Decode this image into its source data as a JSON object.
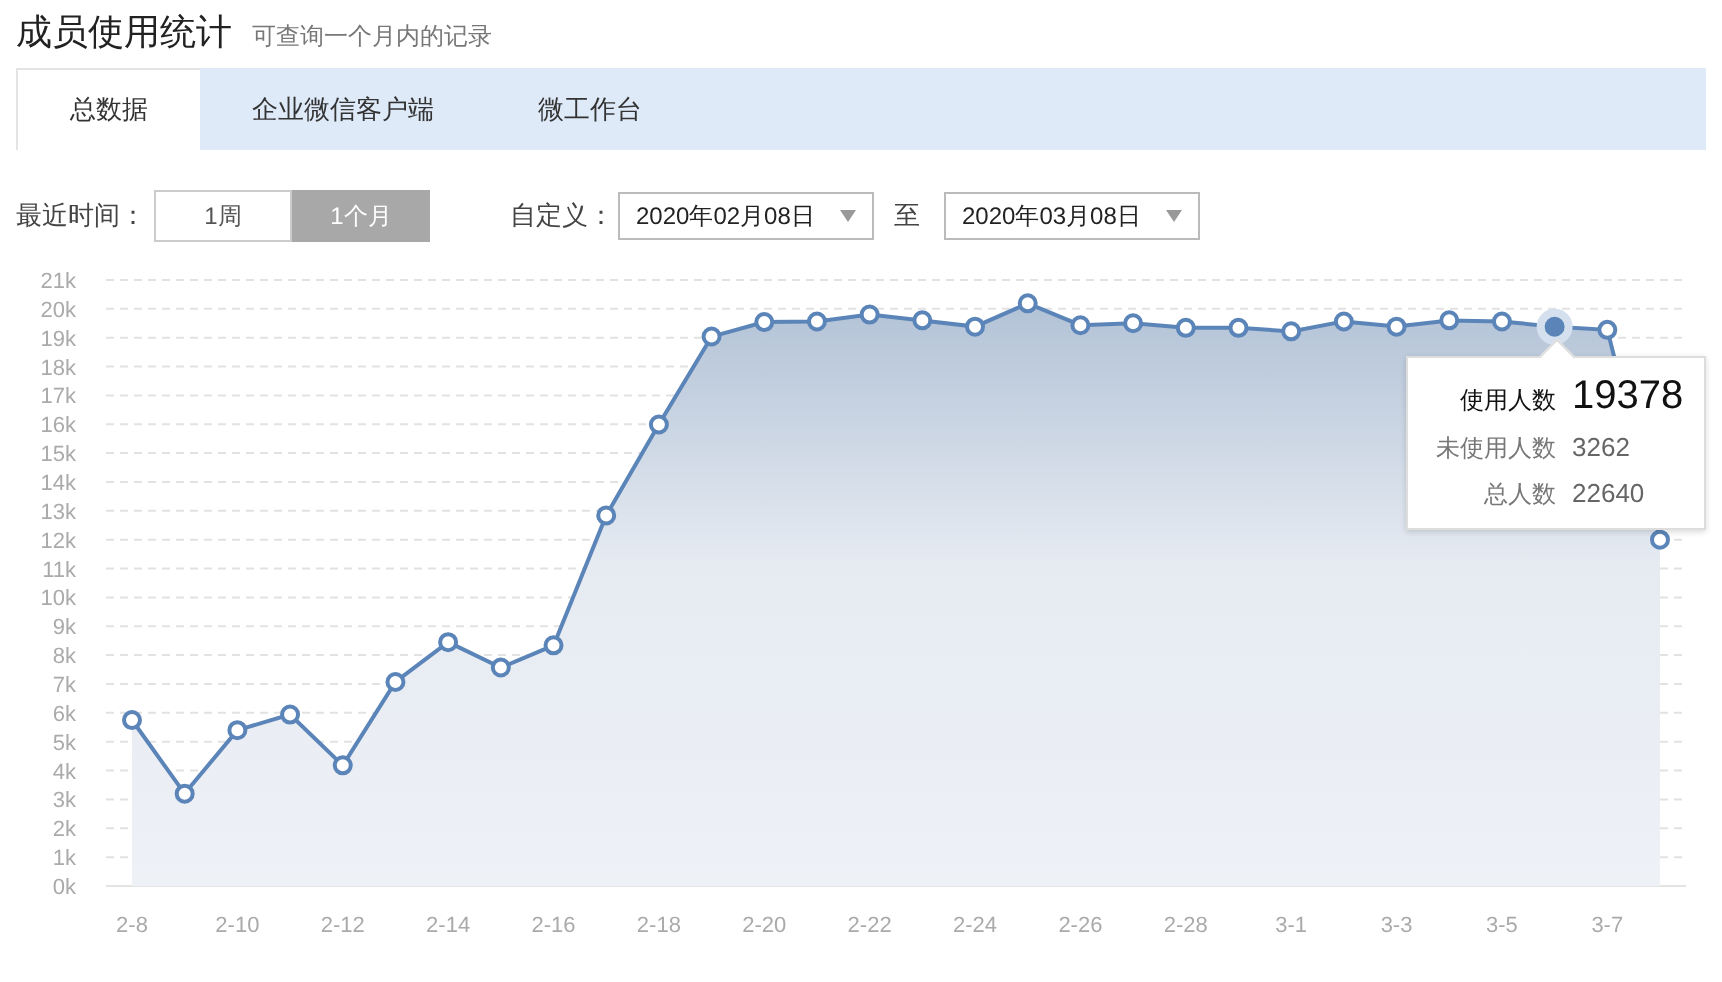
{
  "header": {
    "title": "成员使用统计",
    "subtitle": "可查询一个月内的记录"
  },
  "tabs": [
    {
      "label": "总数据",
      "selected": true
    },
    {
      "label": "企业微信客户端",
      "selected": false
    },
    {
      "label": "微工作台",
      "selected": false
    }
  ],
  "filters": {
    "recent_label": "最近时间：",
    "periods": [
      {
        "label": "1周",
        "selected": false
      },
      {
        "label": "1个月",
        "selected": true
      }
    ],
    "custom_label": "自定义：",
    "start_date": "2020年02月08日",
    "separator": "至",
    "end_date": "2020年03月08日"
  },
  "chart_data": {
    "type": "area",
    "categories": [
      "2-8",
      null,
      "2-10",
      null,
      "2-12",
      null,
      "2-14",
      null,
      "2-16",
      null,
      "2-18",
      null,
      "2-20",
      null,
      "2-22",
      null,
      "2-24",
      null,
      "2-26",
      null,
      "2-28",
      null,
      "3-1",
      null,
      "3-3",
      null,
      "3-5",
      null,
      "3-7",
      null
    ],
    "grid": true,
    "series": [
      {
        "color": "#5b85b8",
        "values": [
          5750,
          3200,
          5400,
          5940,
          4180,
          7070,
          8450,
          7570,
          8340,
          12840,
          15990,
          19040,
          19540,
          19560,
          19800,
          19600,
          19380,
          20190,
          19430,
          19500,
          19340,
          19340,
          19220,
          19560,
          19380,
          19600,
          19560,
          19378,
          19270,
          12000
        ]
      }
    ],
    "ylim": [
      0,
      21000
    ],
    "yticks": [
      {
        "value": 0,
        "label": "0k"
      },
      {
        "value": 1000,
        "label": "1k"
      },
      {
        "value": 2000,
        "label": "2k"
      },
      {
        "value": 3000,
        "label": "3k"
      },
      {
        "value": 4000,
        "label": "4k"
      },
      {
        "value": 5000,
        "label": "5k"
      },
      {
        "value": 6000,
        "label": "6k"
      },
      {
        "value": 7000,
        "label": "7k"
      },
      {
        "value": 8000,
        "label": "8k"
      },
      {
        "value": 9000,
        "label": "9k"
      },
      {
        "value": 10000,
        "label": "10k"
      },
      {
        "value": 11000,
        "label": "11k"
      },
      {
        "value": 12000,
        "label": "12k"
      },
      {
        "value": 13000,
        "label": "13k"
      },
      {
        "value": 14000,
        "label": "14k"
      },
      {
        "value": 15000,
        "label": "15k"
      },
      {
        "value": 16000,
        "label": "16k"
      },
      {
        "value": 17000,
        "label": "17k"
      },
      {
        "value": 18000,
        "label": "18k"
      },
      {
        "value": 19000,
        "label": "19k"
      },
      {
        "value": 20000,
        "label": "20k"
      },
      {
        "value": 21000,
        "label": "21k"
      }
    ]
  },
  "tooltip": {
    "rows": [
      {
        "kind": "primary",
        "label": "使用人数",
        "value": "19378"
      },
      {
        "kind": "secondary",
        "label": "未使用人数",
        "value": "3262"
      },
      {
        "kind": "secondary",
        "label": "总人数",
        "value": "22640"
      }
    ]
  }
}
